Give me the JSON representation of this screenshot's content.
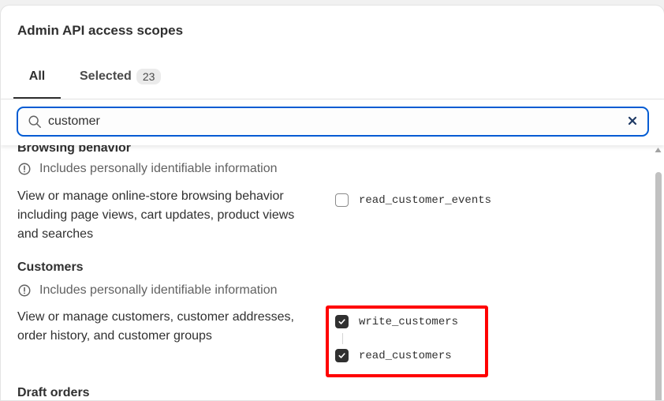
{
  "dialog": {
    "title": "Admin API access scopes"
  },
  "tabs": {
    "all_label": "All",
    "selected_label": "Selected",
    "selected_count": "23"
  },
  "search": {
    "value": "customer",
    "placeholder": "",
    "icon": "search-icon",
    "clear_icon": "close-icon",
    "focus_color": "#005bd3"
  },
  "sections": [
    {
      "title": "Browsing behavior",
      "pii_note": "Includes personally identifiable information",
      "description": "View or manage online-store browsing behavior including page views, cart updates, product views and searches",
      "scopes": [
        {
          "name": "read_customer_events",
          "checked": false
        }
      ]
    },
    {
      "title": "Customers",
      "pii_note": "Includes personally identifiable information",
      "description": "View or manage customers, customer addresses, order history, and customer groups",
      "scopes": [
        {
          "name": "write_customers",
          "checked": true
        },
        {
          "name": "read_customers",
          "checked": true
        }
      ]
    },
    {
      "title": "Draft orders"
    }
  ],
  "highlight_color": "#ff0000"
}
